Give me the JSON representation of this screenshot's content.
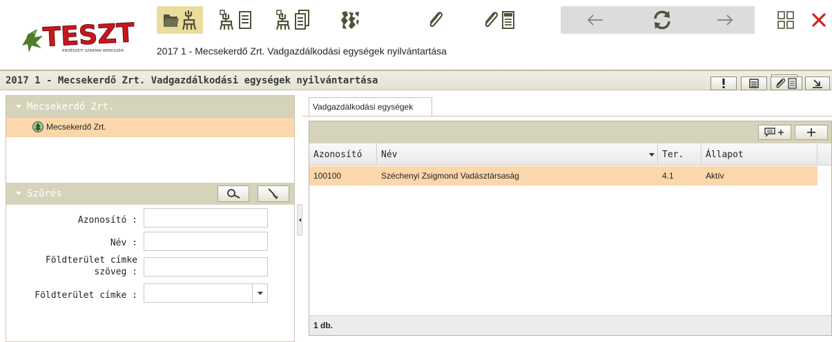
{
  "header": {
    "logo_text": "TESZT",
    "logo_subtext": "ERDÉSZETI SZAKMAI RENDSZER",
    "app_title": "2017 1 - Mecsekerdő Zrt. Vadgazdálkodási egységek nyilvántartása",
    "toolbar": [
      {
        "icon": "folder-deer-icon",
        "active": true
      },
      {
        "icon": "deer-document-icon",
        "active": false
      },
      {
        "icon": "deer-documents-icon",
        "active": false
      },
      {
        "icon": "map-icon",
        "active": false
      },
      {
        "icon": "paperclip-icon",
        "active": false
      },
      {
        "icon": "paperclip-pdf-icon",
        "active": false
      },
      {
        "icon": "back-arrow-icon",
        "active": false
      },
      {
        "icon": "refresh-icon",
        "active": false
      },
      {
        "icon": "forward-arrow-icon",
        "active": false
      },
      {
        "icon": "grid-icon",
        "active": false
      },
      {
        "icon": "close-icon",
        "active": false
      }
    ],
    "colors": {
      "active_tab": "#eadc9e",
      "close": "#d42020",
      "icon": "#4e5238"
    }
  },
  "section": {
    "title": "2017 1 - Mecsekerdő Zrt. Vadgazdálkodási egységek nyilvántartása",
    "buttons": [
      "exclamation-icon",
      "document-icon",
      "attachment-document-icon",
      "export-icon"
    ]
  },
  "left": {
    "org_panel_title": "Mecsekerdő Zrt.",
    "org_item": "Mecsekerdő Zrt.",
    "filter_title": "Szűrés",
    "filter_fields": {
      "azonosito_label": "Azonosító :",
      "azonosito_value": "",
      "nev_label": "Név :",
      "nev_value": "",
      "cimke_szoveg_label_1": "Földterület címke",
      "cimke_szoveg_label_2": "szöveg :",
      "cimke_szoveg_value": "",
      "cimke_label": "Földterület címke :",
      "cimke_selected": ""
    },
    "colors": {
      "panel_header": "#d6d3bb",
      "selected_row": "#fbd7ab"
    }
  },
  "right": {
    "tab_label": "Vadgazdálkodási egységek",
    "columns": [
      "Azonosító",
      "Név",
      "Ter.",
      "Állapot"
    ],
    "rows": [
      {
        "azonosito": "100100",
        "nev": "Széchenyi Zsigmond Vadásztársaság",
        "ter": "4.1",
        "allapot": "Aktív"
      }
    ],
    "footer_count": "1 db."
  }
}
